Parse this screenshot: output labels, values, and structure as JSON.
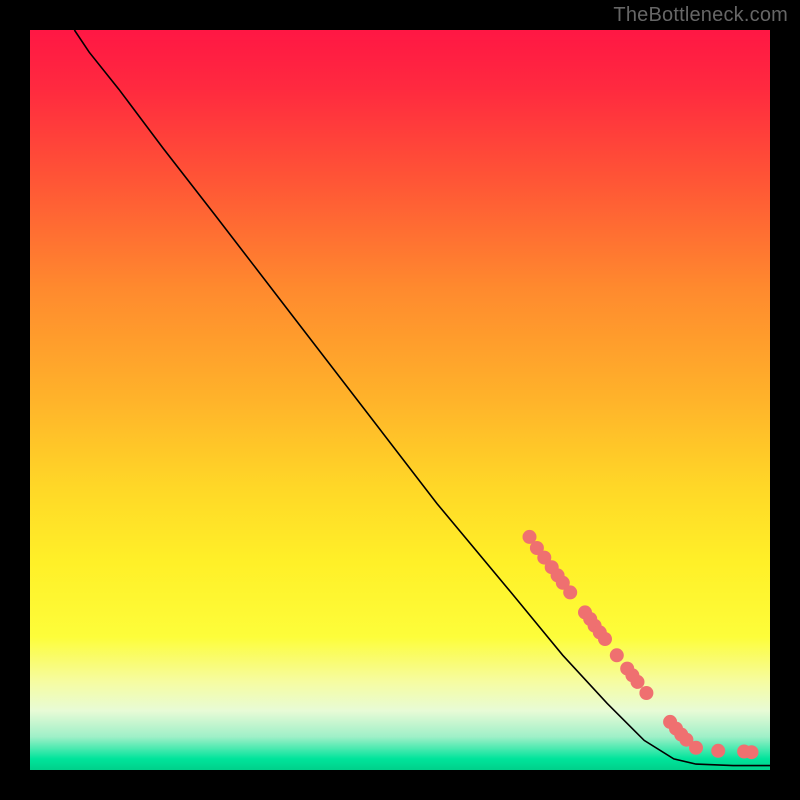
{
  "watermark": "TheBottleneck.com",
  "chart_data": {
    "type": "line",
    "title": "",
    "xlabel": "",
    "ylabel": "",
    "xlim": [
      0,
      100
    ],
    "ylim": [
      0,
      100
    ],
    "background": {
      "gradient_stops": [
        {
          "offset": 0.0,
          "color": "#ff1744"
        },
        {
          "offset": 0.08,
          "color": "#ff2a3f"
        },
        {
          "offset": 0.2,
          "color": "#ff5436"
        },
        {
          "offset": 0.35,
          "color": "#ff8a2e"
        },
        {
          "offset": 0.5,
          "color": "#ffb32a"
        },
        {
          "offset": 0.62,
          "color": "#ffd827"
        },
        {
          "offset": 0.72,
          "color": "#fff028"
        },
        {
          "offset": 0.82,
          "color": "#fdfd3a"
        },
        {
          "offset": 0.88,
          "color": "#f6fca0"
        },
        {
          "offset": 0.92,
          "color": "#e8fbd6"
        },
        {
          "offset": 0.955,
          "color": "#9ff0c8"
        },
        {
          "offset": 0.985,
          "color": "#00e49b"
        },
        {
          "offset": 1.0,
          "color": "#00d08a"
        }
      ]
    },
    "series": [
      {
        "name": "curve",
        "stroke": "#000000",
        "data": [
          {
            "x": 6,
            "y": 100
          },
          {
            "x": 8,
            "y": 97
          },
          {
            "x": 12,
            "y": 92
          },
          {
            "x": 18,
            "y": 84
          },
          {
            "x": 25,
            "y": 75
          },
          {
            "x": 35,
            "y": 62
          },
          {
            "x": 45,
            "y": 49
          },
          {
            "x": 55,
            "y": 36
          },
          {
            "x": 65,
            "y": 24
          },
          {
            "x": 72,
            "y": 15.5
          },
          {
            "x": 78,
            "y": 9
          },
          {
            "x": 83,
            "y": 4
          },
          {
            "x": 87,
            "y": 1.5
          },
          {
            "x": 90,
            "y": 0.8
          },
          {
            "x": 95,
            "y": 0.6
          },
          {
            "x": 100,
            "y": 0.6
          }
        ]
      }
    ],
    "scatter_markers": {
      "name": "markers",
      "color": "#ef7070",
      "radius_px": 7,
      "points": [
        {
          "x": 67.5,
          "y": 31.5
        },
        {
          "x": 68.5,
          "y": 30.0
        },
        {
          "x": 69.5,
          "y": 28.7
        },
        {
          "x": 70.5,
          "y": 27.4
        },
        {
          "x": 71.3,
          "y": 26.3
        },
        {
          "x": 72.0,
          "y": 25.3
        },
        {
          "x": 73.0,
          "y": 24.0
        },
        {
          "x": 75.0,
          "y": 21.3
        },
        {
          "x": 75.7,
          "y": 20.4
        },
        {
          "x": 76.3,
          "y": 19.5
        },
        {
          "x": 77.0,
          "y": 18.6
        },
        {
          "x": 77.7,
          "y": 17.7
        },
        {
          "x": 79.3,
          "y": 15.5
        },
        {
          "x": 80.7,
          "y": 13.7
        },
        {
          "x": 81.4,
          "y": 12.8
        },
        {
          "x": 82.1,
          "y": 11.9
        },
        {
          "x": 83.3,
          "y": 10.4
        },
        {
          "x": 86.5,
          "y": 6.5
        },
        {
          "x": 87.3,
          "y": 5.6
        },
        {
          "x": 88.0,
          "y": 4.8
        },
        {
          "x": 88.7,
          "y": 4.1
        },
        {
          "x": 90.0,
          "y": 3.0
        },
        {
          "x": 93.0,
          "y": 2.6
        },
        {
          "x": 96.5,
          "y": 2.5
        },
        {
          "x": 97.5,
          "y": 2.4
        }
      ]
    }
  }
}
